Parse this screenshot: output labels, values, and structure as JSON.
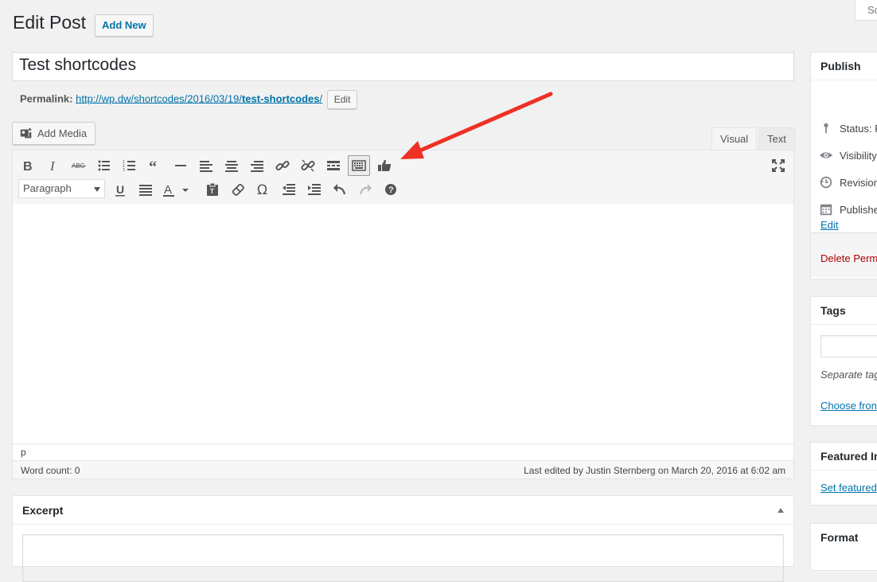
{
  "screen_options": {
    "label": "Sc"
  },
  "header": {
    "title": "Edit Post",
    "add_new_label": "Add New"
  },
  "post": {
    "title_value": "Test shortcodes",
    "permalink_label": "Permalink:",
    "permalink_base": "http://wp.dw/shortcodes/2016/03/19/",
    "permalink_slug": "test-shortcodes",
    "permalink_trailing": "/",
    "permalink_edit_label": "Edit"
  },
  "editor": {
    "add_media_label": "Add Media",
    "tabs": {
      "visual": "Visual",
      "text": "Text"
    },
    "format_select_value": "Paragraph",
    "path": "p",
    "word_count": "Word count: 0",
    "last_edited": "Last edited by Justin Sternberg on March 20, 2016 at 6:02 am"
  },
  "excerpt": {
    "title": "Excerpt"
  },
  "sidebar": {
    "publish": {
      "title": "Publish",
      "status": "Status: F",
      "visibility": "Visibility",
      "revisions": "Revision",
      "published": "Publishe",
      "edit_link": "Edit",
      "delete_link": "Delete Perm"
    },
    "tags": {
      "title": "Tags",
      "help": "Separate tag",
      "choose_link": "Choose fron"
    },
    "featured": {
      "title": "Featured In",
      "set_link": "Set featured"
    },
    "format": {
      "title": "Format"
    }
  },
  "colors": {
    "link": "#0073aa",
    "annotation_arrow": "#ee3124",
    "delete": "#a00"
  }
}
